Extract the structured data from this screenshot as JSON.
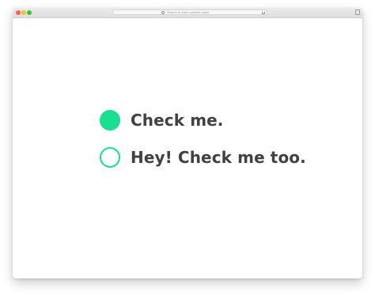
{
  "browser": {
    "address_placeholder": "Search or enter website name"
  },
  "options": [
    {
      "label": "Check me.",
      "checked": true
    },
    {
      "label": "Hey! Check me too.",
      "checked": false
    }
  ],
  "colors": {
    "accent": "#19e08f",
    "text": "#414141"
  }
}
